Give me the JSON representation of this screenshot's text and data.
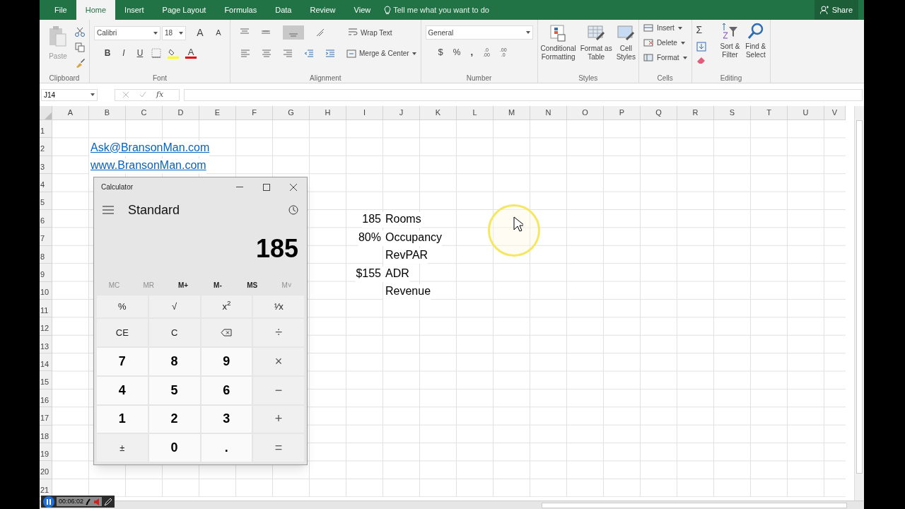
{
  "tabs": [
    {
      "label": "File",
      "selected": false
    },
    {
      "label": "Home",
      "selected": true
    },
    {
      "label": "Insert",
      "selected": false
    },
    {
      "label": "Page Layout",
      "selected": false
    },
    {
      "label": "Formulas",
      "selected": false
    },
    {
      "label": "Data",
      "selected": false
    },
    {
      "label": "Review",
      "selected": false
    },
    {
      "label": "View",
      "selected": false
    }
  ],
  "tell_me": "Tell me what you want to do",
  "share": "Share",
  "ribbon": {
    "clipboard": {
      "paste": "Paste",
      "group": "Clipboard"
    },
    "font": {
      "name": "Calibri",
      "size": "18",
      "grow": "A",
      "shrink": "A",
      "bold": "B",
      "italic": "I",
      "underline": "U",
      "font_color": "A",
      "group": "Font"
    },
    "alignment": {
      "wrap": "Wrap Text",
      "merge": "Merge & Center",
      "group": "Alignment"
    },
    "number": {
      "format": "General",
      "currency": "$",
      "percent": "%",
      "comma": ",",
      "increase_decimal": [
        ".0",
        ".00"
      ],
      "decrease_decimal": [
        ".00",
        ".0"
      ],
      "group": "Number"
    },
    "styles": {
      "buttons": [
        {
          "lines": [
            "Conditional",
            "Formatting"
          ]
        },
        {
          "lines": [
            "Format as",
            "Table"
          ]
        },
        {
          "lines": [
            "Cell",
            "Styles"
          ]
        }
      ],
      "group": "Styles"
    },
    "cells": {
      "buttons": [
        "Insert",
        "Delete",
        "Format"
      ],
      "group": "Cells"
    },
    "editing": {
      "sum": "Σ",
      "buttons": [
        {
          "lines": [
            "Sort &",
            "Filter"
          ]
        },
        {
          "lines": [
            "Find &",
            "Select"
          ]
        }
      ],
      "group": "Editing"
    }
  },
  "formula_bar": {
    "name_box": "J14",
    "function_label": "fx"
  },
  "columns": [
    "A",
    "B",
    "C",
    "D",
    "E",
    "F",
    "G",
    "H",
    "I",
    "J",
    "K",
    "L",
    "M",
    "N",
    "O",
    "P",
    "Q",
    "R",
    "S",
    "T",
    "U",
    "V"
  ],
  "rows": [
    {
      "label": "1"
    },
    {
      "label": "2",
      "cells": {
        "B": {
          "text": "Ask@BransonMan.com",
          "kind": "link"
        }
      }
    },
    {
      "label": "3",
      "cells": {
        "B": {
          "text": "www.BransonMan.com",
          "kind": "link"
        }
      }
    },
    {
      "label": "4"
    },
    {
      "label": "5"
    },
    {
      "label": "6",
      "cells": {
        "I": {
          "text": "185",
          "kind": "number"
        },
        "J": {
          "text": "Rooms",
          "kind": "text"
        }
      }
    },
    {
      "label": "7",
      "cells": {
        "I": {
          "text": "80%",
          "kind": "number"
        },
        "J": {
          "text": "Occupancy",
          "kind": "text"
        }
      }
    },
    {
      "label": "8",
      "cells": {
        "J": {
          "text": "RevPAR",
          "kind": "text"
        }
      }
    },
    {
      "label": "9",
      "cells": {
        "I": {
          "text": "$155",
          "kind": "number"
        },
        "J": {
          "text": "ADR",
          "kind": "text"
        }
      }
    },
    {
      "label": "10",
      "cells": {
        "J": {
          "text": "Revenue",
          "kind": "text"
        }
      }
    },
    {
      "label": "11"
    },
    {
      "label": "12"
    },
    {
      "label": "13"
    },
    {
      "label": "14"
    },
    {
      "label": "15"
    },
    {
      "label": "16"
    },
    {
      "label": "17"
    },
    {
      "label": "18"
    },
    {
      "label": "19"
    },
    {
      "label": "20"
    },
    {
      "label": "21"
    }
  ],
  "calculator": {
    "title": "Calculator",
    "mode": "Standard",
    "display": "185",
    "memory": [
      {
        "label": "MC",
        "disabled": true
      },
      {
        "label": "MR",
        "disabled": true
      },
      {
        "label": "M+",
        "disabled": false
      },
      {
        "label": "M-",
        "disabled": false
      },
      {
        "label": "MS",
        "disabled": false
      },
      {
        "label": "M˅",
        "disabled": true
      }
    ],
    "keys": [
      {
        "label": "%",
        "kind": "function"
      },
      {
        "label": "√",
        "kind": "function"
      },
      {
        "label": "x$^{2}$",
        "kind": "function"
      },
      {
        "label": "¹⁄x",
        "kind": "function"
      },
      {
        "label": "CE",
        "kind": "function"
      },
      {
        "label": "C",
        "kind": "function"
      },
      {
        "kind": "backspace"
      },
      {
        "label": "÷",
        "kind": "operator"
      },
      {
        "label": "7",
        "kind": "digit"
      },
      {
        "label": "8",
        "kind": "digit"
      },
      {
        "label": "9",
        "kind": "digit"
      },
      {
        "label": "×",
        "kind": "operator"
      },
      {
        "label": "4",
        "kind": "digit"
      },
      {
        "label": "5",
        "kind": "digit"
      },
      {
        "label": "6",
        "kind": "digit"
      },
      {
        "label": "−",
        "kind": "operator"
      },
      {
        "label": "1",
        "kind": "digit"
      },
      {
        "label": "2",
        "kind": "digit"
      },
      {
        "label": "3",
        "kind": "digit"
      },
      {
        "label": "+",
        "kind": "operator"
      },
      {
        "label": "±",
        "kind": "function"
      },
      {
        "label": "0",
        "kind": "digit"
      },
      {
        "label": ".",
        "kind": "digit"
      },
      {
        "label": "=",
        "kind": "operator"
      }
    ]
  },
  "recorder": {
    "time": "00:06:02"
  }
}
